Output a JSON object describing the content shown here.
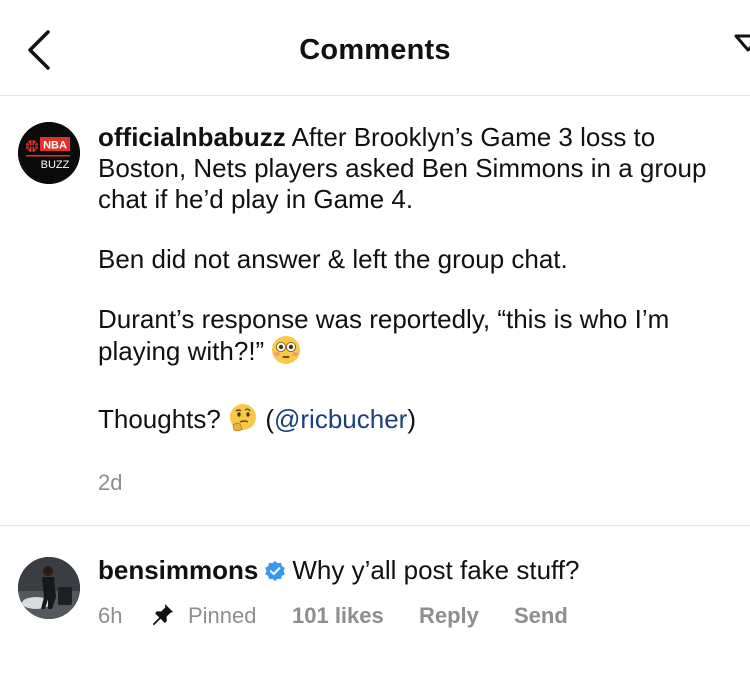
{
  "header": {
    "title": "Comments",
    "back_icon": "chevron-left-icon",
    "send_icon": "paper-plane-icon"
  },
  "post": {
    "username": "officialnbabuzz",
    "avatar_text_top": "NBA",
    "avatar_text_bottom": "BUZZ",
    "line1_rest": " After Brooklyn’s Game 3 loss to Boston, Nets players asked Ben Simmons in a group chat if he’d play in Game 4.",
    "paragraph2": "Ben did not answer & left the group chat.",
    "paragraph3": "Durant’s response was reportedly, “this is who I’m playing with?!”",
    "paragraph3_emoji": "flushed-face-emoji",
    "paragraph4_text": "Thoughts?",
    "paragraph4_emoji": "thinking-face-emoji",
    "mention_open": " (",
    "mention": "@ricbucher",
    "mention_close": ")",
    "timestamp": "2d"
  },
  "comment": {
    "username": "bensimmons",
    "verified_icon": "verified-badge-icon",
    "text": "Why y’all post fake stuff?",
    "time": "6h",
    "pinned_label": "Pinned",
    "pin_icon": "pin-icon",
    "likes": "101 likes",
    "reply_label": "Reply",
    "send_label": "Send"
  },
  "colors": {
    "accent_link": "#1d3f7a",
    "meta_gray": "#8e8e8e",
    "verified_blue": "#3897f0",
    "nba_red": "#e0312b"
  }
}
